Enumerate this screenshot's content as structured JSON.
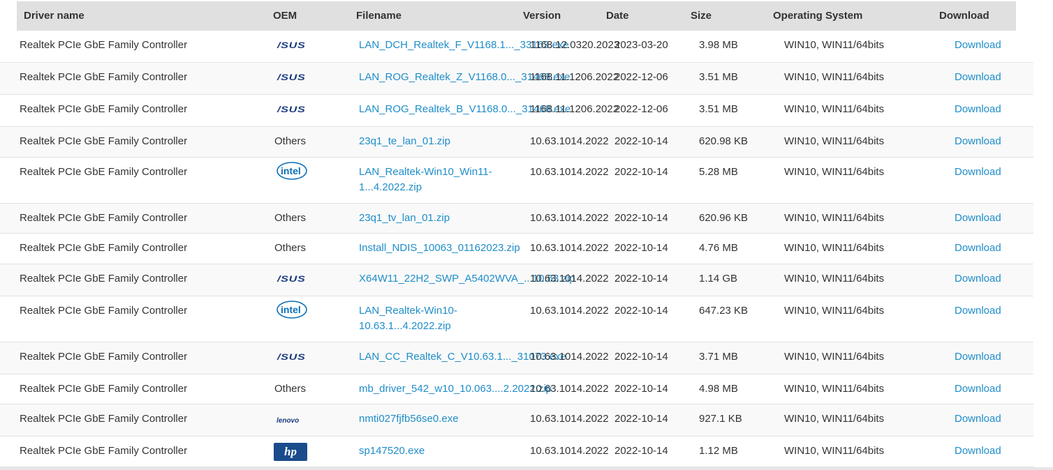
{
  "header": {
    "driver_name": "Driver name",
    "oem": "OEM",
    "filename": "Filename",
    "version": "Version",
    "date": "Date",
    "size": "Size",
    "os": "Operating System",
    "download": "Download"
  },
  "rows": [
    {
      "driver": "Realtek PCIe GbE Family Controller",
      "oem_logo": "asus-logo",
      "oem_text": "/SUS",
      "filename": "LAN_DCH_Realtek_F_V1168.1..._33163.exe",
      "version": "1168.12.0320.2023",
      "date": "2023-03-20",
      "size": "3.98 MB",
      "os": "WIN10, WIN11/64bits",
      "download": "Download"
    },
    {
      "driver": "Realtek PCIe GbE Family Controller",
      "oem_logo": "asus-logo",
      "oem_text": "/SUS",
      "filename": "LAN_ROG_Realtek_Z_V1168.0..._31468.exe",
      "version": "1168.11.1206.2022",
      "date": "2022-12-06",
      "size": "3.51 MB",
      "os": "WIN10, WIN11/64bits",
      "download": "Download"
    },
    {
      "driver": "Realtek PCIe GbE Family Controller",
      "oem_logo": "asus-logo",
      "oem_text": "/SUS",
      "filename": "LAN_ROG_Realtek_B_V1168.0..._31468.exe",
      "version": "1168.11.1206.2022",
      "date": "2022-12-06",
      "size": "3.51 MB",
      "os": "WIN10, WIN11/64bits",
      "download": "Download"
    },
    {
      "driver": "Realtek PCIe GbE Family Controller",
      "oem_logo": "none",
      "oem_text": "Others",
      "filename": "23q1_te_lan_01.zip",
      "version": "10.63.1014.2022",
      "date": "2022-10-14",
      "size": "620.98 KB",
      "os": "WIN10, WIN11/64bits",
      "download": "Download"
    },
    {
      "driver": "Realtek PCIe GbE Family Controller",
      "oem_logo": "intel-logo",
      "oem_text": "intel",
      "filename": "LAN_Realtek-Win10_Win11-1...4.2022.zip",
      "version": "10.63.1014.2022",
      "date": "2022-10-14",
      "size": "5.28 MB",
      "os": "WIN10, WIN11/64bits",
      "download": "Download"
    },
    {
      "driver": "Realtek PCIe GbE Family Controller",
      "oem_logo": "none",
      "oem_text": "Others",
      "filename": "23q1_tv_lan_01.zip",
      "version": "10.63.1014.2022",
      "date": "2022-10-14",
      "size": "620.96 KB",
      "os": "WIN10, WIN11/64bits",
      "download": "Download"
    },
    {
      "driver": "Realtek PCIe GbE Family Controller",
      "oem_logo": "none",
      "oem_text": "Others",
      "filename": "Install_NDIS_10063_01162023.zip",
      "version": "10.63.1014.2022",
      "date": "2022-10-14",
      "size": "4.76 MB",
      "os": "WIN10, WIN11/64bits",
      "download": "Download"
    },
    {
      "driver": "Realtek PCIe GbE Family Controller",
      "oem_logo": "asus-logo",
      "oem_text": "/SUS",
      "filename": "X64W11_22H2_SWP_A5402WVA_...10.63.zip",
      "version": "10.63.1014.2022",
      "date": "2022-10-14",
      "size": "1.14 GB",
      "os": "WIN10, WIN11/64bits",
      "download": "Download"
    },
    {
      "driver": "Realtek PCIe GbE Family Controller",
      "oem_logo": "intel-logo",
      "oem_text": "intel",
      "filename": "LAN_Realtek-Win10-10.63.1...4.2022.zip",
      "version": "10.63.1014.2022",
      "date": "2022-10-14",
      "size": "647.23 KB",
      "os": "WIN10, WIN11/64bits",
      "download": "Download"
    },
    {
      "driver": "Realtek PCIe GbE Family Controller",
      "oem_logo": "asus-logo",
      "oem_text": "/SUS",
      "filename": "LAN_CC_Realtek_C_V10.63.1..._31073.exe",
      "version": "10.63.1014.2022",
      "date": "2022-10-14",
      "size": "3.71 MB",
      "os": "WIN10, WIN11/64bits",
      "download": "Download"
    },
    {
      "driver": "Realtek PCIe GbE Family Controller",
      "oem_logo": "none",
      "oem_text": "Others",
      "filename": "mb_driver_542_w10_10.063....2.2022.zip",
      "version": "10.63.1014.2022",
      "date": "2022-10-14",
      "size": "4.98 MB",
      "os": "WIN10, WIN11/64bits",
      "download": "Download"
    },
    {
      "driver": "Realtek PCIe GbE Family Controller",
      "oem_logo": "lenovo-logo",
      "oem_text": "lenovo",
      "filename": "nmti027fjfb56se0.exe",
      "version": "10.63.1014.2022",
      "date": "2022-10-14",
      "size": "927.1 KB",
      "os": "WIN10, WIN11/64bits",
      "download": "Download"
    },
    {
      "driver": "Realtek PCIe GbE Family Controller",
      "oem_logo": "hp-logo",
      "oem_text": "hp",
      "filename": "sp147520.exe",
      "version": "10.63.1014.2022",
      "date": "2022-10-14",
      "size": "1.12 MB",
      "os": "WIN10, WIN11/64bits",
      "download": "Download"
    }
  ]
}
